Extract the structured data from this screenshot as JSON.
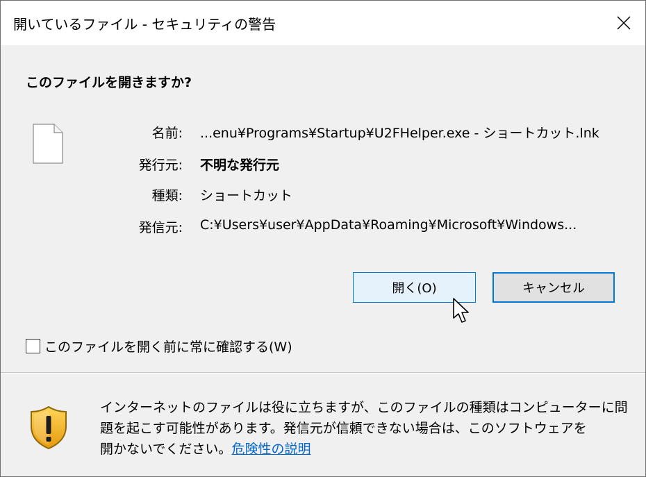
{
  "window": {
    "title": "開いているファイル - セキュリティの警告"
  },
  "dialog": {
    "heading": "このファイルを開きますか?",
    "fields": [
      {
        "label": "名前:",
        "value": "...enu¥Programs¥Startup¥U2FHelper.exe - ショートカット.lnk"
      },
      {
        "label": "発行元:",
        "value": "不明な発行元"
      },
      {
        "label": "種類:",
        "value": "ショートカット"
      },
      {
        "label": "発信元:",
        "value": "C:¥Users¥user¥AppData¥Roaming¥Microsoft¥Windows..."
      }
    ],
    "open_label": "開く(O)",
    "cancel_label": "キャンセル",
    "checkbox_label": "このファイルを開く前に常に確認する(W)",
    "checkbox_checked": false
  },
  "warning": {
    "line1": "インターネットのファイルは役に立ちますが、このファイルの種類はコンピューターに問",
    "line2": "題を起こす可能性があります。発信元が信頼できない場合は、このソフトウェアを",
    "line3_prefix": "開かないでください。",
    "link_text": "危険性の説明"
  },
  "icons": {
    "file": "file-icon",
    "shield": "shield-warning-icon",
    "close": "close-icon",
    "cursor": "mouse-cursor-icon"
  },
  "colors": {
    "accent": "#0078d7",
    "link": "#0066cc",
    "shield_gold": "#f5b51c"
  }
}
